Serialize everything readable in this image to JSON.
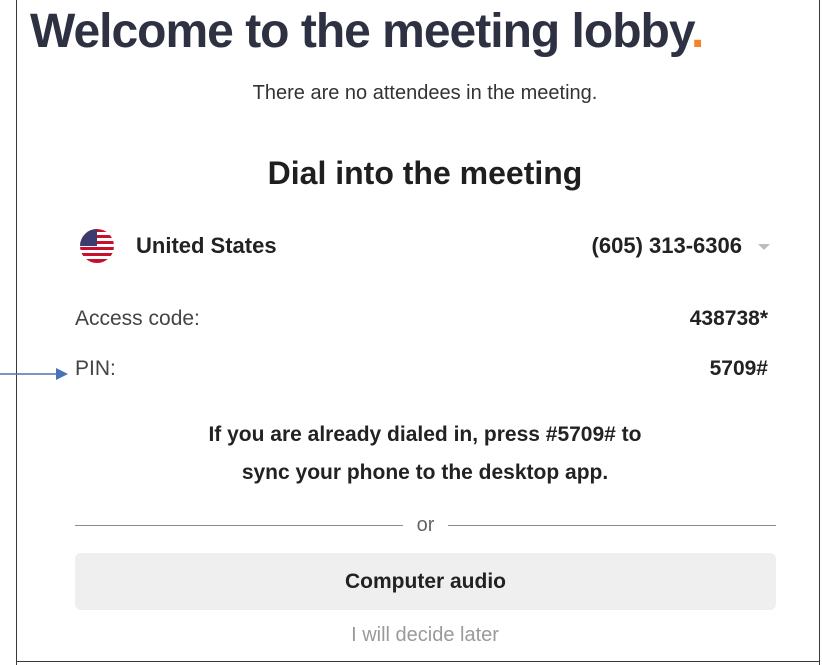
{
  "header": {
    "title": "Welcome to the meeting lobby",
    "title_dot": "."
  },
  "lobby": {
    "attendees_status": "There are no attendees in the meeting."
  },
  "dial_in": {
    "heading": "Dial into the meeting",
    "country": {
      "name": "United States",
      "flag_icon": "us-flag-icon",
      "phone_number": "(605) 313-6306"
    },
    "access_code_label": "Access code:",
    "access_code_value": "438738*",
    "pin_label": "PIN:",
    "pin_value": "5709#",
    "sync_line1": "If you are already dialed in, press #5709# to",
    "sync_line2": "sync your phone to the desktop app."
  },
  "divider": {
    "text": "or"
  },
  "actions": {
    "computer_audio_label": "Computer audio",
    "decide_later_label": "I will decide later"
  },
  "colors": {
    "title": "#2d3142",
    "accent_dot": "#f5832a",
    "button_bg": "#efefef",
    "annotation_arrow": "#4a72b8"
  }
}
